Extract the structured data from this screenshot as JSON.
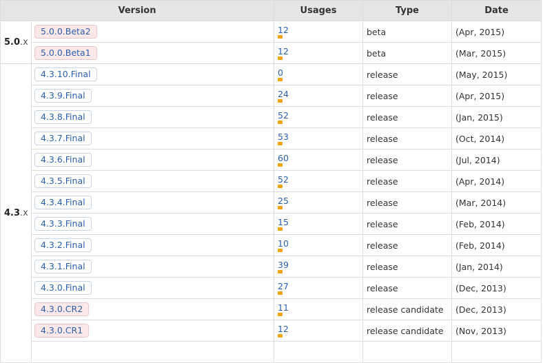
{
  "headers": {
    "version": "Version",
    "usages": "Usages",
    "type": "Type",
    "date": "Date"
  },
  "groups": [
    {
      "major": "5.0",
      "suffix": ".x",
      "rows": [
        {
          "version": "5.0.0.Beta2",
          "usages": "12",
          "type": "beta",
          "date": "(Apr, 2015)",
          "prerelease": true
        },
        {
          "version": "5.0.0.Beta1",
          "usages": "12",
          "type": "beta",
          "date": "(Mar, 2015)",
          "prerelease": true
        }
      ]
    },
    {
      "major": "4.3",
      "suffix": ".x",
      "rows": [
        {
          "version": "4.3.10.Final",
          "usages": "0",
          "type": "release",
          "date": "(May, 2015)",
          "prerelease": false
        },
        {
          "version": "4.3.9.Final",
          "usages": "24",
          "type": "release",
          "date": "(Apr, 2015)",
          "prerelease": false
        },
        {
          "version": "4.3.8.Final",
          "usages": "52",
          "type": "release",
          "date": "(Jan, 2015)",
          "prerelease": false
        },
        {
          "version": "4.3.7.Final",
          "usages": "53",
          "type": "release",
          "date": "(Oct, 2014)",
          "prerelease": false
        },
        {
          "version": "4.3.6.Final",
          "usages": "60",
          "type": "release",
          "date": "(Jul, 2014)",
          "prerelease": false
        },
        {
          "version": "4.3.5.Final",
          "usages": "52",
          "type": "release",
          "date": "(Apr, 2014)",
          "prerelease": false
        },
        {
          "version": "4.3.4.Final",
          "usages": "25",
          "type": "release",
          "date": "(Mar, 2014)",
          "prerelease": false
        },
        {
          "version": "4.3.3.Final",
          "usages": "15",
          "type": "release",
          "date": "(Feb, 2014)",
          "prerelease": false
        },
        {
          "version": "4.3.2.Final",
          "usages": "10",
          "type": "release",
          "date": "(Feb, 2014)",
          "prerelease": false
        },
        {
          "version": "4.3.1.Final",
          "usages": "39",
          "type": "release",
          "date": "(Jan, 2014)",
          "prerelease": false
        },
        {
          "version": "4.3.0.Final",
          "usages": "27",
          "type": "release",
          "date": "(Dec, 2013)",
          "prerelease": false
        },
        {
          "version": "4.3.0.CR2",
          "usages": "11",
          "type": "release candidate",
          "date": "(Dec, 2013)",
          "prerelease": true
        },
        {
          "version": "4.3.0.CR1",
          "usages": "12",
          "type": "release candidate",
          "date": "(Nov, 2013)",
          "prerelease": true
        }
      ]
    }
  ],
  "colors": {
    "header_bg": "#e6e6e6",
    "link": "#2b5fae",
    "usage_bar": "#f0a30a",
    "prerelease_bg": "#fbe9ea"
  }
}
